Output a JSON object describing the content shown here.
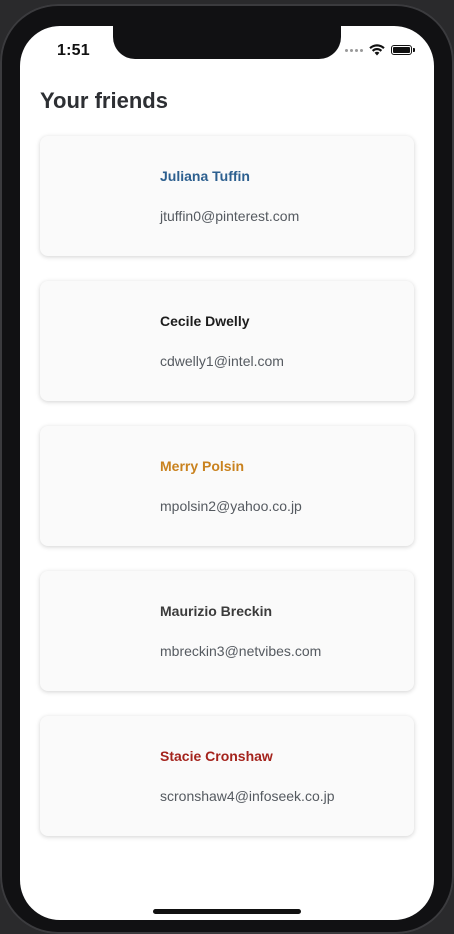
{
  "status_bar": {
    "time": "1:51"
  },
  "page": {
    "title": "Your friends"
  },
  "friends": [
    {
      "name": "Juliana Tuffin",
      "email": "jtuffin0@pinterest.com",
      "name_color": "#2c5f8f"
    },
    {
      "name": "Cecile Dwelly",
      "email": "cdwelly1@intel.com",
      "name_color": "#1c1c1c"
    },
    {
      "name": "Merry Polsin",
      "email": "mpolsin2@yahoo.co.jp",
      "name_color": "#c9821e"
    },
    {
      "name": "Maurizio Breckin",
      "email": "mbreckin3@netvibes.com",
      "name_color": "#3b3b3b"
    },
    {
      "name": "Stacie Cronshaw",
      "email": "scronshaw4@infoseek.co.jp",
      "name_color": "#a4231c"
    }
  ],
  "icons": {
    "signal": "cellular-signal-icon",
    "wifi": "wifi-icon",
    "battery": "battery-icon"
  }
}
